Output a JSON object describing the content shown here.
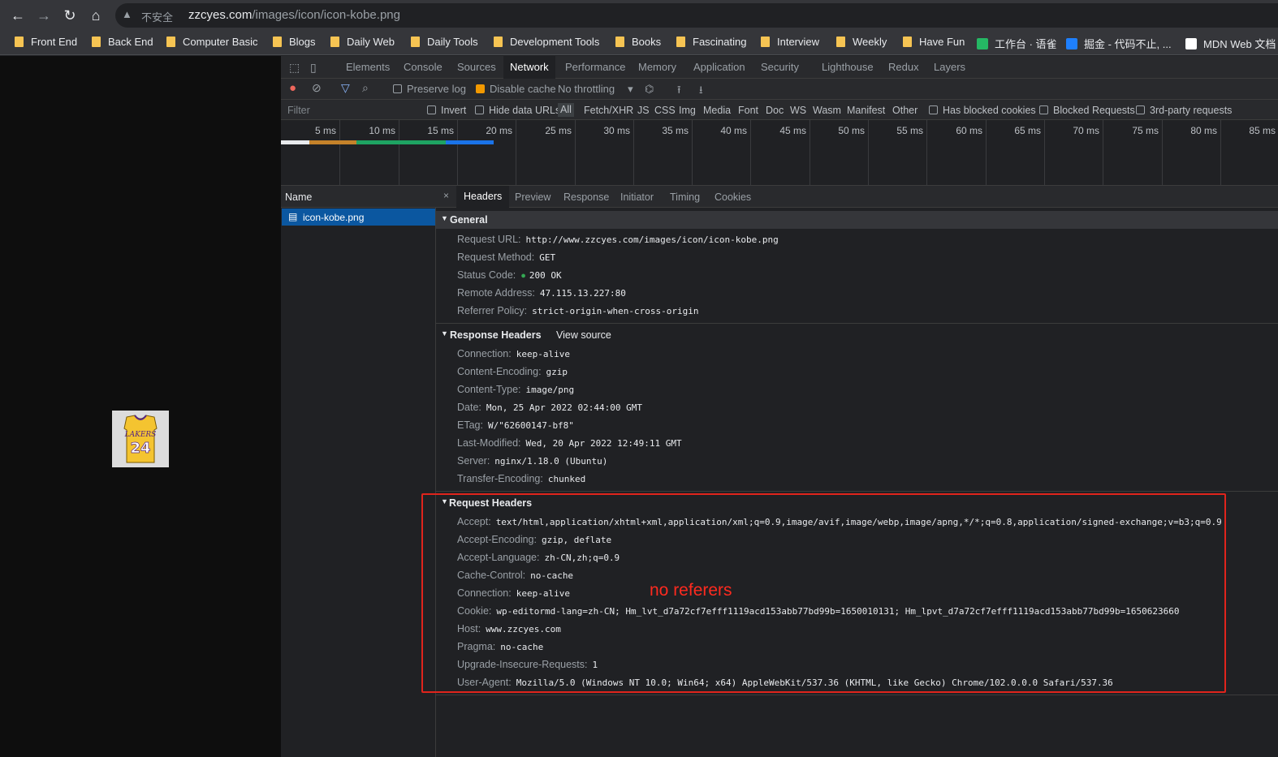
{
  "browser": {
    "insecure_label": "不安全",
    "url_domain": "zzcyes.com",
    "url_path": "/images/icon/icon-kobe.png",
    "bookmarks": [
      "Front End",
      "Back End",
      "Computer Basic",
      "Blogs",
      "Daily Web",
      "Daily Tools",
      "Development Tools",
      "Books",
      "Fascinating",
      "Interview",
      "Weekly",
      "Have Fun",
      "工作台 · 语雀",
      "掘金 - 代码不止, ...",
      "MDN Web 文档"
    ]
  },
  "page": {
    "jersey_text": "LAKERS",
    "jersey_number": "24"
  },
  "devtools": {
    "tabs": [
      "Elements",
      "Console",
      "Sources",
      "Network",
      "Performance",
      "Memory",
      "Application",
      "Security",
      "Lighthouse",
      "Redux",
      "Layers"
    ],
    "active_tab": "Network",
    "toolbar": {
      "preserve_log": "Preserve log",
      "disable_cache": "Disable cache",
      "throttling": "No throttling"
    },
    "filter": {
      "placeholder": "Filter",
      "invert": "Invert",
      "hide_data_urls": "Hide data URLs",
      "types": [
        "All",
        "Fetch/XHR",
        "JS",
        "CSS",
        "Img",
        "Media",
        "Font",
        "Doc",
        "WS",
        "Wasm",
        "Manifest",
        "Other"
      ],
      "has_blocked_cookies": "Has blocked cookies",
      "blocked_requests": "Blocked Requests",
      "third_party": "3rd-party requests"
    },
    "timeline_ticks": [
      "5 ms",
      "10 ms",
      "15 ms",
      "20 ms",
      "25 ms",
      "30 ms",
      "35 ms",
      "40 ms",
      "45 ms",
      "50 ms",
      "55 ms",
      "60 ms",
      "65 ms",
      "70 ms",
      "75 ms",
      "80 ms",
      "85 ms"
    ],
    "name_header": "Name",
    "request_name": "icon-kobe.png",
    "detail_tabs": [
      "Headers",
      "Preview",
      "Response",
      "Initiator",
      "Timing",
      "Cookies"
    ],
    "general": {
      "title": "General",
      "rows": [
        {
          "k": "Request URL:",
          "v": "http://www.zzcyes.com/images/icon/icon-kobe.png"
        },
        {
          "k": "Request Method:",
          "v": "GET"
        },
        {
          "k": "Status Code:",
          "v": "200 OK"
        },
        {
          "k": "Remote Address:",
          "v": "47.115.13.227:80"
        },
        {
          "k": "Referrer Policy:",
          "v": "strict-origin-when-cross-origin"
        }
      ]
    },
    "response_headers": {
      "title": "Response Headers",
      "view_source": "View source",
      "rows": [
        {
          "k": "Connection:",
          "v": "keep-alive"
        },
        {
          "k": "Content-Encoding:",
          "v": "gzip"
        },
        {
          "k": "Content-Type:",
          "v": "image/png"
        },
        {
          "k": "Date:",
          "v": "Mon, 25 Apr 2022 02:44:00 GMT"
        },
        {
          "k": "ETag:",
          "v": "W/\"62600147-bf8\""
        },
        {
          "k": "Last-Modified:",
          "v": "Wed, 20 Apr 2022 12:49:11 GMT"
        },
        {
          "k": "Server:",
          "v": "nginx/1.18.0 (Ubuntu)"
        },
        {
          "k": "Transfer-Encoding:",
          "v": "chunked"
        }
      ]
    },
    "request_headers": {
      "title": "Request Headers",
      "rows": [
        {
          "k": "Accept:",
          "v": "text/html,application/xhtml+xml,application/xml;q=0.9,image/avif,image/webp,image/apng,*/*;q=0.8,application/signed-exchange;v=b3;q=0.9"
        },
        {
          "k": "Accept-Encoding:",
          "v": "gzip, deflate"
        },
        {
          "k": "Accept-Language:",
          "v": "zh-CN,zh;q=0.9"
        },
        {
          "k": "Cache-Control:",
          "v": "no-cache"
        },
        {
          "k": "Connection:",
          "v": "keep-alive"
        },
        {
          "k": "Cookie:",
          "v": "wp-editormd-lang=zh-CN; Hm_lvt_d7a72cf7efff1119acd153abb77bd99b=1650010131; Hm_lpvt_d7a72cf7efff1119acd153abb77bd99b=1650623660"
        },
        {
          "k": "Host:",
          "v": "www.zzcyes.com"
        },
        {
          "k": "Pragma:",
          "v": "no-cache"
        },
        {
          "k": "Upgrade-Insecure-Requests:",
          "v": "1"
        },
        {
          "k": "User-Agent:",
          "v": "Mozilla/5.0 (Windows NT 10.0; Win64; x64) AppleWebKit/537.36 (KHTML, like Gecko) Chrome/102.0.0.0 Safari/537.36"
        }
      ]
    },
    "annotation": "no referers",
    "colors": {
      "accent": "#0b57a0",
      "status_ok": "#34a853",
      "annotation": "#ff2a1f"
    }
  }
}
